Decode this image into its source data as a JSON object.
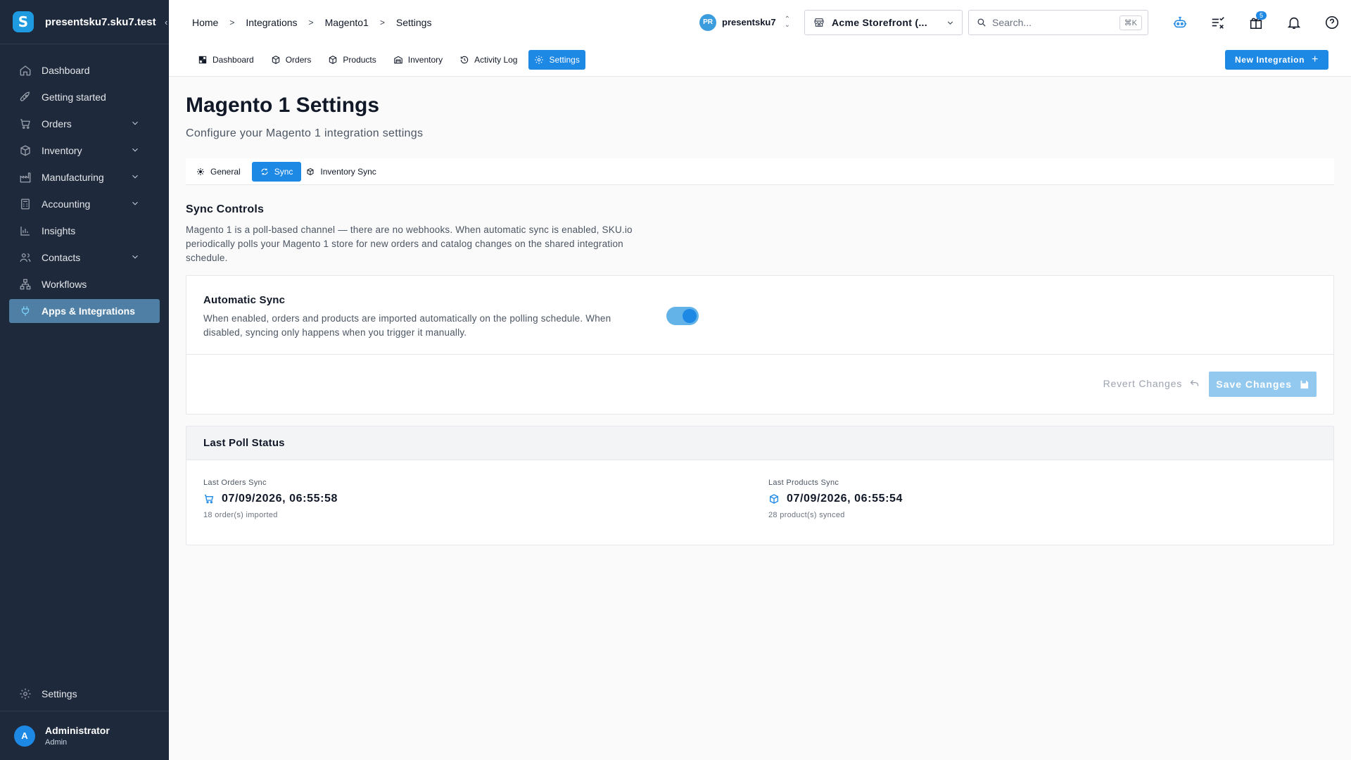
{
  "brand": {
    "logo_letter": "S",
    "account": "presentsku7.sku7.test"
  },
  "sidebar": {
    "items": [
      {
        "label": "Dashboard",
        "icon": "home-icon"
      },
      {
        "label": "Getting started",
        "icon": "rocket-icon"
      },
      {
        "label": "Orders",
        "icon": "cart-icon"
      },
      {
        "label": "Inventory",
        "icon": "box-icon"
      },
      {
        "label": "Manufacturing",
        "icon": "factory-icon"
      },
      {
        "label": "Accounting",
        "icon": "calculator-icon"
      },
      {
        "label": "Insights",
        "icon": "bar-chart-icon"
      },
      {
        "label": "Contacts",
        "icon": "users-icon"
      },
      {
        "label": "Workflows",
        "icon": "workflow-icon"
      },
      {
        "label": "Apps & Integrations",
        "icon": "plug-icon"
      }
    ],
    "settings_label": "Settings",
    "user": {
      "initial": "A",
      "name": "Administrator",
      "role": "Admin"
    }
  },
  "breadcrumb": [
    "Home",
    "Integrations",
    "Magento1",
    "Settings"
  ],
  "topbar": {
    "org_initials": "PR",
    "org_name": "presentsku7",
    "store": "Acme Storefront (...",
    "search_placeholder": "Search...",
    "search_shortcut": "⌘K",
    "gift_count": "5"
  },
  "subnav": {
    "tabs": [
      "Dashboard",
      "Orders",
      "Products",
      "Inventory",
      "Activity Log",
      "Settings"
    ],
    "new_integration": "New Integration"
  },
  "page": {
    "title": "Magento 1 Settings",
    "subtitle": "Configure your Magento 1 integration settings",
    "tabs": [
      "General",
      "Sync",
      "Inventory Sync"
    ]
  },
  "sync_controls": {
    "title": "Sync Controls",
    "description": "Magento 1 is a poll-based channel — there are no webhooks. When automatic sync is enabled, SKU.io periodically polls your Magento 1 store for new orders and catalog changes on the shared integration schedule.",
    "auto_title": "Automatic Sync",
    "auto_desc": "When enabled, orders and products are imported automatically on the polling schedule. When disabled, syncing only happens when you trigger it manually.",
    "auto_enabled": true,
    "revert_label": "Revert Changes",
    "save_label": "Save Changes"
  },
  "poll_status": {
    "title": "Last Poll Status",
    "orders_label": "Last Orders Sync",
    "orders_time": "07/09/2026, 06:55:58",
    "orders_note": "18 order(s) imported",
    "products_label": "Last Products Sync",
    "products_time": "07/09/2026, 06:55:54",
    "products_note": "28 product(s) synced"
  },
  "colors": {
    "accent": "#1e88e5",
    "sidebar_bg": "#1e293b",
    "active_nav": "#4f7fa5"
  }
}
